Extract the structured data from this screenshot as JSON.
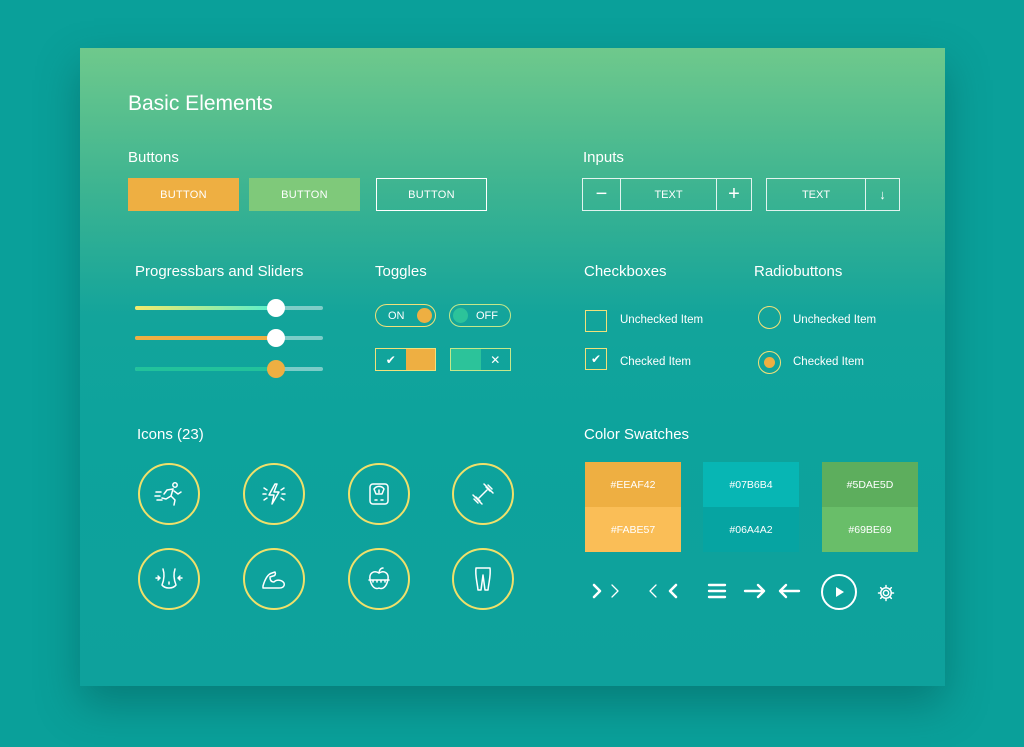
{
  "title": "Basic Elements",
  "sections": {
    "buttons": "Buttons",
    "inputs": "Inputs",
    "progress": "Progressbars and Sliders",
    "toggles": "Toggles",
    "checkboxes": "Checkboxes",
    "radios": "Radiobuttons",
    "icons": "Icons (23)",
    "swatches": "Color Swatches"
  },
  "buttons": [
    {
      "label": "BUTTON",
      "style": "filled",
      "color": "#EEAF42"
    },
    {
      "label": "BUTTON",
      "style": "filled",
      "color": "#69BE69"
    },
    {
      "label": "BUTTON",
      "style": "outline",
      "color": "#FFFFFF"
    }
  ],
  "inputs": {
    "stepper": {
      "minus": "−",
      "value": "TEXT",
      "plus": "+"
    },
    "select": {
      "value": "TEXT",
      "arrow": "↓"
    }
  },
  "sliders": [
    {
      "value": 0.79,
      "fill": "gradient-yellow-cyan"
    },
    {
      "value": 0.79,
      "fill": "#EEAF42"
    },
    {
      "value": 0.79,
      "fill": "#1fbf9a"
    }
  ],
  "toggles": {
    "on_label": "ON",
    "off_label": "OFF",
    "check_glyph": "✔",
    "cross_glyph": "✕"
  },
  "checkboxes": [
    {
      "label": "Unchecked Item",
      "checked": false
    },
    {
      "label": "Checked Item",
      "checked": true,
      "mark": "✔"
    }
  ],
  "radiobuttons": [
    {
      "label": "Unchecked Item",
      "checked": false
    },
    {
      "label": "Checked Item",
      "checked": true
    }
  ],
  "icons": [
    "running-icon",
    "energy-icon",
    "scale-icon",
    "dumbbell-icon",
    "waist-icon",
    "bicep-icon",
    "apple-measure-icon",
    "legs-icon"
  ],
  "swatches": [
    {
      "top": "#EEAF42",
      "bottom": "#FABE57"
    },
    {
      "top": "#07B6B4",
      "bottom": "#06A4A2"
    },
    {
      "top": "#5DAE5D",
      "bottom": "#69BE69"
    }
  ],
  "nav_icons": [
    "chevron-right-outline-icon",
    "chevron-left-outline-icon",
    "hamburger-icon",
    "arrow-right-icon",
    "arrow-left-icon",
    "play-icon",
    "gear-icon"
  ],
  "colors": {
    "accent_orange": "#EEAF42",
    "accent_green": "#69BE69",
    "outline_yellow": "#F0E06A"
  }
}
